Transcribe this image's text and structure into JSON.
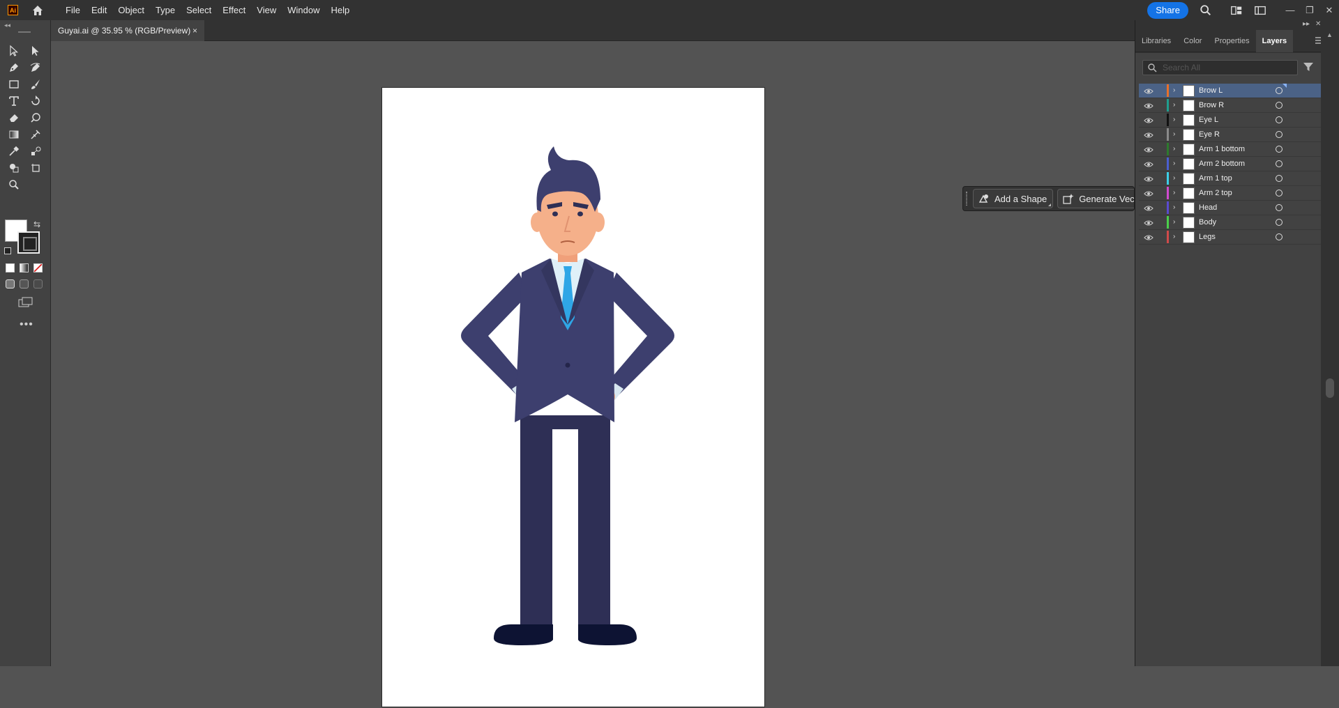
{
  "app": {
    "logo_text": "Ai",
    "menu": [
      "File",
      "Edit",
      "Object",
      "Type",
      "Select",
      "Effect",
      "View",
      "Window",
      "Help"
    ],
    "share_label": "Share"
  },
  "document": {
    "tab_title": "Guyai.ai @ 35.95 % (RGB/Preview)",
    "tab_close": "×"
  },
  "taskbar": {
    "add_shape_label": "Add a Shape",
    "generate_label": "Generate Vect"
  },
  "panel": {
    "tabs": [
      "Libraries",
      "Color",
      "Properties",
      "Layers"
    ],
    "active_tab": "Layers",
    "search_placeholder": "Search All",
    "layers": [
      {
        "name": "Brow L",
        "color": "#e8702a",
        "selected": true
      },
      {
        "name": "Brow R",
        "color": "#1f9e8f",
        "selected": false
      },
      {
        "name": "Eye L",
        "color": "#111111",
        "selected": false
      },
      {
        "name": "Eye R",
        "color": "#8a8a8a",
        "selected": false
      },
      {
        "name": "Arm 1 bottom",
        "color": "#2d7a2d",
        "selected": false
      },
      {
        "name": "Arm 2 bottom",
        "color": "#4a5fd0",
        "selected": false
      },
      {
        "name": "Arm 1 top",
        "color": "#3cd0e8",
        "selected": false
      },
      {
        "name": "Arm 2 top",
        "color": "#d04ad0",
        "selected": false
      },
      {
        "name": "Head",
        "color": "#5a4ad0",
        "selected": false
      },
      {
        "name": "Body",
        "color": "#4ad04a",
        "selected": false
      },
      {
        "name": "Legs",
        "color": "#d04a4a",
        "selected": false
      }
    ]
  },
  "colors": {
    "accent": "#1473e6",
    "selection": "#4b6286",
    "suit": "#3d3f6e",
    "tie": "#2fa6e6",
    "skin": "#f5b08a"
  }
}
